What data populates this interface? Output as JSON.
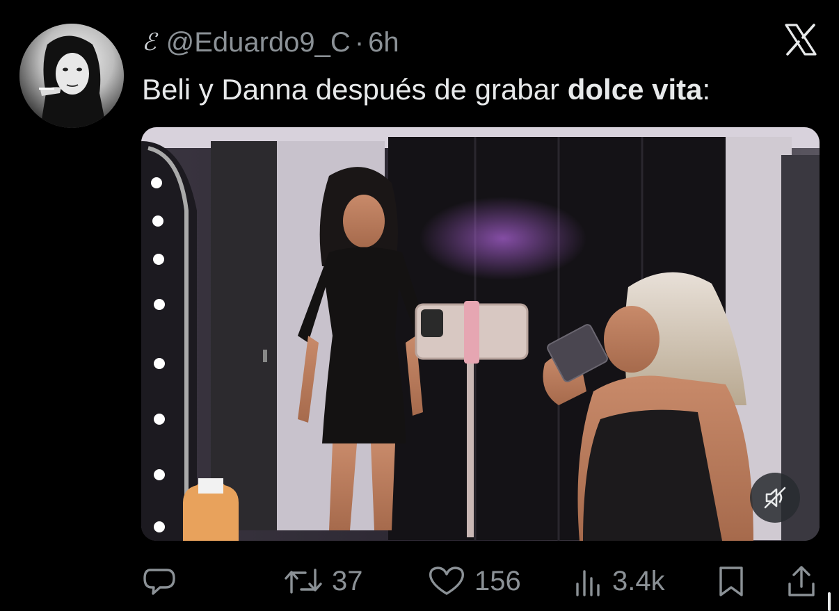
{
  "author": {
    "name_glyph": "ℰ",
    "handle": "@Eduardo9_C",
    "separator": "·",
    "time_ago": "6h"
  },
  "platform_icon": "x-logo-icon",
  "tweet": {
    "text_plain": "Beli y Danna después de grabar ",
    "text_bold": "dolce vita",
    "text_end": ":"
  },
  "media": {
    "type": "video",
    "muted": true,
    "mute_icon": "speaker-muted-icon"
  },
  "actions": {
    "reply": {
      "icon": "reply-icon",
      "count": ""
    },
    "retweet": {
      "icon": "retweet-icon",
      "count": "37"
    },
    "like": {
      "icon": "heart-icon",
      "count": "156"
    },
    "views": {
      "icon": "analytics-icon",
      "count": "3.4k"
    },
    "bookmark": {
      "icon": "bookmark-icon"
    },
    "share": {
      "icon": "share-icon"
    }
  },
  "colors": {
    "background": "#000000",
    "text_primary": "#e7e9ea",
    "text_secondary": "#8b9196"
  }
}
